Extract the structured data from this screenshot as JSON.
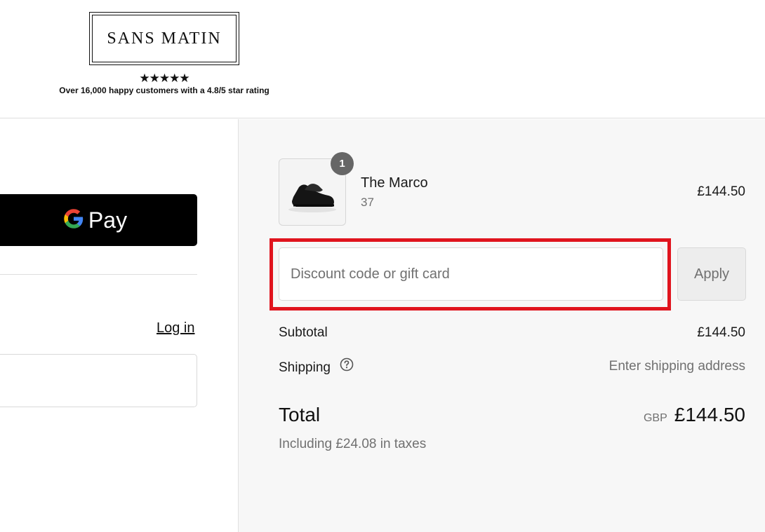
{
  "header": {
    "brand": "SANS MATIN",
    "stars": "★★★★★",
    "tagline": "Over 16,000 happy customers with a 4.8/5 star rating"
  },
  "express_checkout": {
    "gpay_label": "Pay"
  },
  "contact": {
    "login_label": "Log in",
    "email_value": ""
  },
  "order_summary": {
    "items": [
      {
        "quantity": "1",
        "name": "The Marco",
        "variant": "37",
        "price": "£144.50"
      }
    ],
    "discount": {
      "placeholder": "Discount code or gift card",
      "value": "",
      "apply_label": "Apply"
    },
    "subtotal_label": "Subtotal",
    "subtotal_value": "£144.50",
    "shipping_label": "Shipping",
    "shipping_value": "Enter shipping address",
    "total_label": "Total",
    "currency": "GBP",
    "total_value": "£144.50",
    "taxes_note": "Including £24.08 in taxes"
  },
  "colors": {
    "highlight": "#e0141e",
    "gpay_bg": "#000000",
    "summary_bg": "#f7f7f7"
  },
  "icons": [
    "google-g-icon",
    "help-circle-icon",
    "shoe-thumbnail"
  ]
}
